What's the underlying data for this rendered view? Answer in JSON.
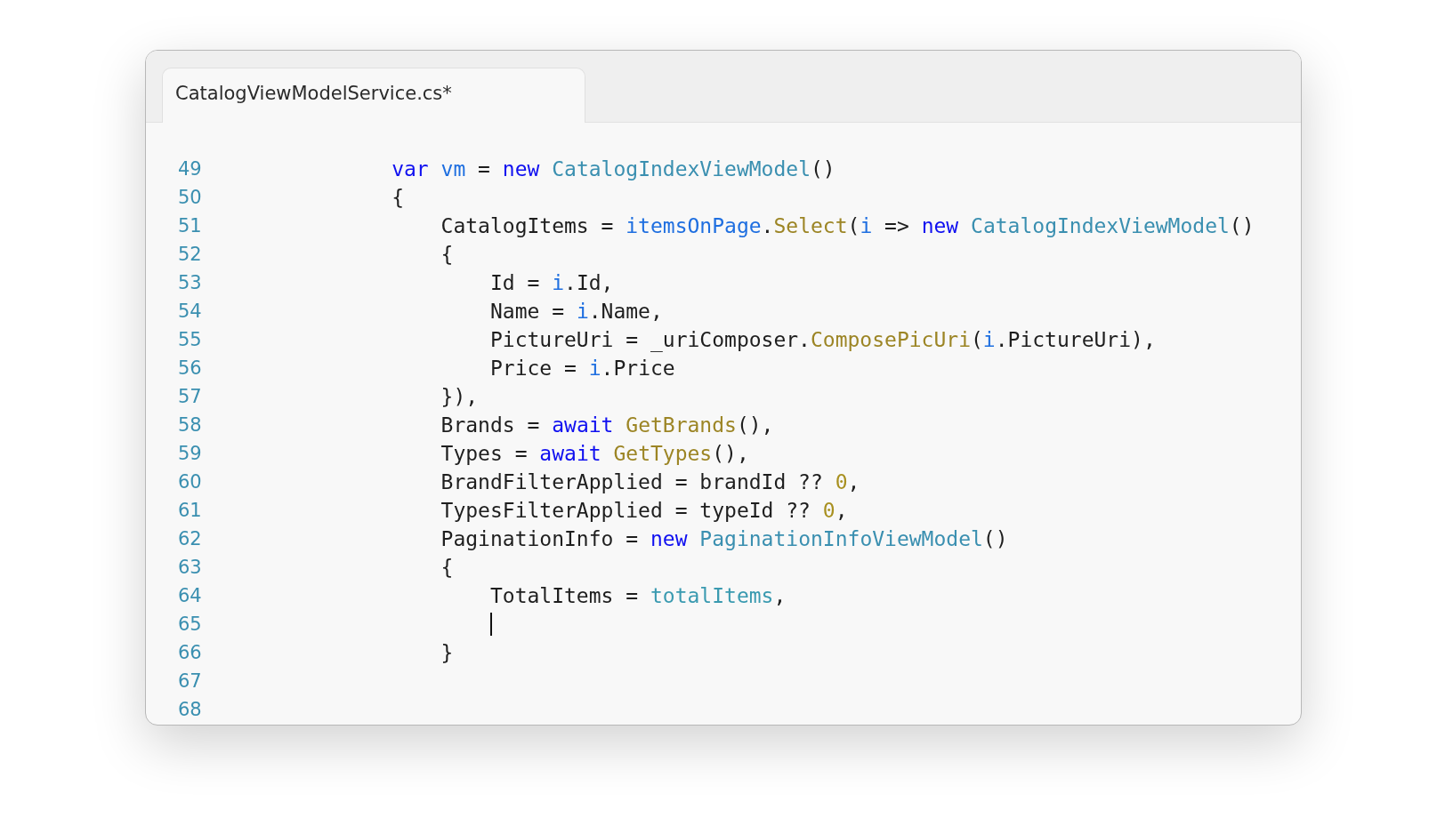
{
  "tabs": [
    {
      "label": "CatalogViewModelService.cs*",
      "selected": true
    }
  ],
  "lines": [
    {
      "number": "49",
      "caret": false,
      "tokens": [
        {
          "kind": "keyword",
          "text": "            var"
        },
        {
          "kind": "param",
          "text": " vm"
        },
        {
          "kind": "plain",
          "text": " = "
        },
        {
          "kind": "keyword",
          "text": "new"
        },
        {
          "kind": "type",
          "text": " CatalogIndexViewModel"
        },
        {
          "kind": "plain",
          "text": "()"
        }
      ]
    },
    {
      "number": "50",
      "caret": false,
      "tokens": [
        {
          "kind": "plain",
          "text": "            {"
        }
      ]
    },
    {
      "number": "51",
      "caret": false,
      "tokens": [
        {
          "kind": "plain",
          "text": "                CatalogItems = "
        },
        {
          "kind": "param",
          "text": "itemsOnPage"
        },
        {
          "kind": "plain",
          "text": "."
        },
        {
          "kind": "method",
          "text": "Select"
        },
        {
          "kind": "plain",
          "text": "("
        },
        {
          "kind": "param",
          "text": "i"
        },
        {
          "kind": "plain",
          "text": " => "
        },
        {
          "kind": "keyword",
          "text": "new"
        },
        {
          "kind": "type",
          "text": " CatalogIndexViewModel"
        },
        {
          "kind": "plain",
          "text": "()"
        }
      ]
    },
    {
      "number": "52",
      "caret": false,
      "tokens": [
        {
          "kind": "plain",
          "text": "                {"
        }
      ]
    },
    {
      "number": "53",
      "caret": false,
      "tokens": [
        {
          "kind": "plain",
          "text": "                    Id = "
        },
        {
          "kind": "param",
          "text": "i"
        },
        {
          "kind": "plain",
          "text": ".Id,"
        }
      ]
    },
    {
      "number": "54",
      "caret": false,
      "tokens": [
        {
          "kind": "plain",
          "text": "                    Name = "
        },
        {
          "kind": "param",
          "text": "i"
        },
        {
          "kind": "plain",
          "text": ".Name,"
        }
      ]
    },
    {
      "number": "55",
      "caret": false,
      "tokens": [
        {
          "kind": "plain",
          "text": "                    PictureUri = _uriComposer."
        },
        {
          "kind": "method",
          "text": "ComposePicUri"
        },
        {
          "kind": "plain",
          "text": "("
        },
        {
          "kind": "param",
          "text": "i"
        },
        {
          "kind": "plain",
          "text": ".PictureUri),"
        }
      ]
    },
    {
      "number": "56",
      "caret": false,
      "tokens": [
        {
          "kind": "plain",
          "text": "                    Price = "
        },
        {
          "kind": "param",
          "text": "i"
        },
        {
          "kind": "plain",
          "text": ".Price"
        }
      ]
    },
    {
      "number": "57",
      "caret": false,
      "tokens": [
        {
          "kind": "plain",
          "text": "                }),"
        }
      ]
    },
    {
      "number": "58",
      "caret": false,
      "tokens": [
        {
          "kind": "plain",
          "text": "                Brands = "
        },
        {
          "kind": "keyword",
          "text": "await"
        },
        {
          "kind": "method",
          "text": " GetBrands"
        },
        {
          "kind": "plain",
          "text": "(),"
        }
      ]
    },
    {
      "number": "59",
      "caret": false,
      "tokens": [
        {
          "kind": "plain",
          "text": "                Types = "
        },
        {
          "kind": "keyword",
          "text": "await"
        },
        {
          "kind": "method",
          "text": " GetTypes"
        },
        {
          "kind": "plain",
          "text": "(),"
        }
      ]
    },
    {
      "number": "60",
      "caret": false,
      "tokens": [
        {
          "kind": "plain",
          "text": "                BrandFilterApplied = brandId ?? "
        },
        {
          "kind": "number",
          "text": "0"
        },
        {
          "kind": "plain",
          "text": ","
        }
      ]
    },
    {
      "number": "61",
      "caret": false,
      "tokens": [
        {
          "kind": "plain",
          "text": "                TypesFilterApplied = typeId ?? "
        },
        {
          "kind": "number",
          "text": "0"
        },
        {
          "kind": "plain",
          "text": ","
        }
      ]
    },
    {
      "number": "62",
      "caret": false,
      "tokens": [
        {
          "kind": "plain",
          "text": "                PaginationInfo = "
        },
        {
          "kind": "keyword",
          "text": "new"
        },
        {
          "kind": "type",
          "text": " PaginationInfoViewModel"
        },
        {
          "kind": "plain",
          "text": "()"
        }
      ]
    },
    {
      "number": "63",
      "caret": false,
      "tokens": [
        {
          "kind": "plain",
          "text": "                {"
        }
      ]
    },
    {
      "number": "64",
      "caret": false,
      "tokens": [
        {
          "kind": "plain",
          "text": "                    TotalItems = "
        },
        {
          "kind": "field",
          "text": "totalItems"
        },
        {
          "kind": "plain",
          "text": ","
        }
      ]
    },
    {
      "number": "65",
      "caret": true
    },
    {
      "number": "66",
      "caret": false,
      "tokens": [
        {
          "kind": "plain",
          "text": "                }"
        }
      ]
    },
    {
      "number": "67",
      "caret": false
    },
    {
      "number": "68",
      "caret": false
    }
  ]
}
